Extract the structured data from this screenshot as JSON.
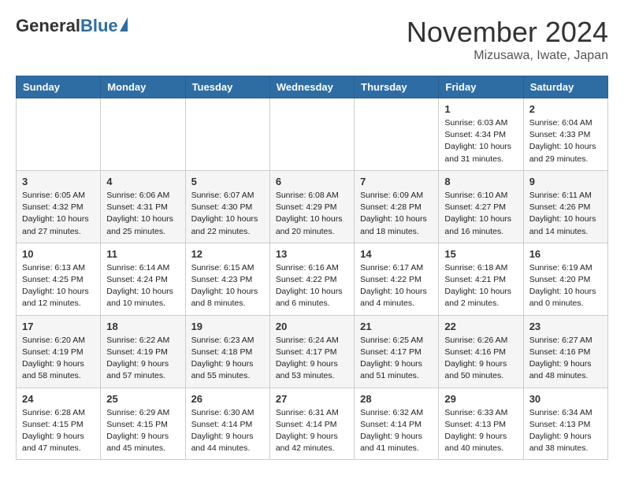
{
  "header": {
    "logo_general": "General",
    "logo_blue": "Blue",
    "month_title": "November 2024",
    "location": "Mizusawa, Iwate, Japan"
  },
  "weekdays": [
    "Sunday",
    "Monday",
    "Tuesday",
    "Wednesday",
    "Thursday",
    "Friday",
    "Saturday"
  ],
  "weeks": [
    [
      {
        "day": "",
        "info": ""
      },
      {
        "day": "",
        "info": ""
      },
      {
        "day": "",
        "info": ""
      },
      {
        "day": "",
        "info": ""
      },
      {
        "day": "",
        "info": ""
      },
      {
        "day": "1",
        "info": "Sunrise: 6:03 AM\nSunset: 4:34 PM\nDaylight: 10 hours\nand 31 minutes."
      },
      {
        "day": "2",
        "info": "Sunrise: 6:04 AM\nSunset: 4:33 PM\nDaylight: 10 hours\nand 29 minutes."
      }
    ],
    [
      {
        "day": "3",
        "info": "Sunrise: 6:05 AM\nSunset: 4:32 PM\nDaylight: 10 hours\nand 27 minutes."
      },
      {
        "day": "4",
        "info": "Sunrise: 6:06 AM\nSunset: 4:31 PM\nDaylight: 10 hours\nand 25 minutes."
      },
      {
        "day": "5",
        "info": "Sunrise: 6:07 AM\nSunset: 4:30 PM\nDaylight: 10 hours\nand 22 minutes."
      },
      {
        "day": "6",
        "info": "Sunrise: 6:08 AM\nSunset: 4:29 PM\nDaylight: 10 hours\nand 20 minutes."
      },
      {
        "day": "7",
        "info": "Sunrise: 6:09 AM\nSunset: 4:28 PM\nDaylight: 10 hours\nand 18 minutes."
      },
      {
        "day": "8",
        "info": "Sunrise: 6:10 AM\nSunset: 4:27 PM\nDaylight: 10 hours\nand 16 minutes."
      },
      {
        "day": "9",
        "info": "Sunrise: 6:11 AM\nSunset: 4:26 PM\nDaylight: 10 hours\nand 14 minutes."
      }
    ],
    [
      {
        "day": "10",
        "info": "Sunrise: 6:13 AM\nSunset: 4:25 PM\nDaylight: 10 hours\nand 12 minutes."
      },
      {
        "day": "11",
        "info": "Sunrise: 6:14 AM\nSunset: 4:24 PM\nDaylight: 10 hours\nand 10 minutes."
      },
      {
        "day": "12",
        "info": "Sunrise: 6:15 AM\nSunset: 4:23 PM\nDaylight: 10 hours\nand 8 minutes."
      },
      {
        "day": "13",
        "info": "Sunrise: 6:16 AM\nSunset: 4:22 PM\nDaylight: 10 hours\nand 6 minutes."
      },
      {
        "day": "14",
        "info": "Sunrise: 6:17 AM\nSunset: 4:22 PM\nDaylight: 10 hours\nand 4 minutes."
      },
      {
        "day": "15",
        "info": "Sunrise: 6:18 AM\nSunset: 4:21 PM\nDaylight: 10 hours\nand 2 minutes."
      },
      {
        "day": "16",
        "info": "Sunrise: 6:19 AM\nSunset: 4:20 PM\nDaylight: 10 hours\nand 0 minutes."
      }
    ],
    [
      {
        "day": "17",
        "info": "Sunrise: 6:20 AM\nSunset: 4:19 PM\nDaylight: 9 hours\nand 58 minutes."
      },
      {
        "day": "18",
        "info": "Sunrise: 6:22 AM\nSunset: 4:19 PM\nDaylight: 9 hours\nand 57 minutes."
      },
      {
        "day": "19",
        "info": "Sunrise: 6:23 AM\nSunset: 4:18 PM\nDaylight: 9 hours\nand 55 minutes."
      },
      {
        "day": "20",
        "info": "Sunrise: 6:24 AM\nSunset: 4:17 PM\nDaylight: 9 hours\nand 53 minutes."
      },
      {
        "day": "21",
        "info": "Sunrise: 6:25 AM\nSunset: 4:17 PM\nDaylight: 9 hours\nand 51 minutes."
      },
      {
        "day": "22",
        "info": "Sunrise: 6:26 AM\nSunset: 4:16 PM\nDaylight: 9 hours\nand 50 minutes."
      },
      {
        "day": "23",
        "info": "Sunrise: 6:27 AM\nSunset: 4:16 PM\nDaylight: 9 hours\nand 48 minutes."
      }
    ],
    [
      {
        "day": "24",
        "info": "Sunrise: 6:28 AM\nSunset: 4:15 PM\nDaylight: 9 hours\nand 47 minutes."
      },
      {
        "day": "25",
        "info": "Sunrise: 6:29 AM\nSunset: 4:15 PM\nDaylight: 9 hours\nand 45 minutes."
      },
      {
        "day": "26",
        "info": "Sunrise: 6:30 AM\nSunset: 4:14 PM\nDaylight: 9 hours\nand 44 minutes."
      },
      {
        "day": "27",
        "info": "Sunrise: 6:31 AM\nSunset: 4:14 PM\nDaylight: 9 hours\nand 42 minutes."
      },
      {
        "day": "28",
        "info": "Sunrise: 6:32 AM\nSunset: 4:14 PM\nDaylight: 9 hours\nand 41 minutes."
      },
      {
        "day": "29",
        "info": "Sunrise: 6:33 AM\nSunset: 4:13 PM\nDaylight: 9 hours\nand 40 minutes."
      },
      {
        "day": "30",
        "info": "Sunrise: 6:34 AM\nSunset: 4:13 PM\nDaylight: 9 hours\nand 38 minutes."
      }
    ]
  ]
}
